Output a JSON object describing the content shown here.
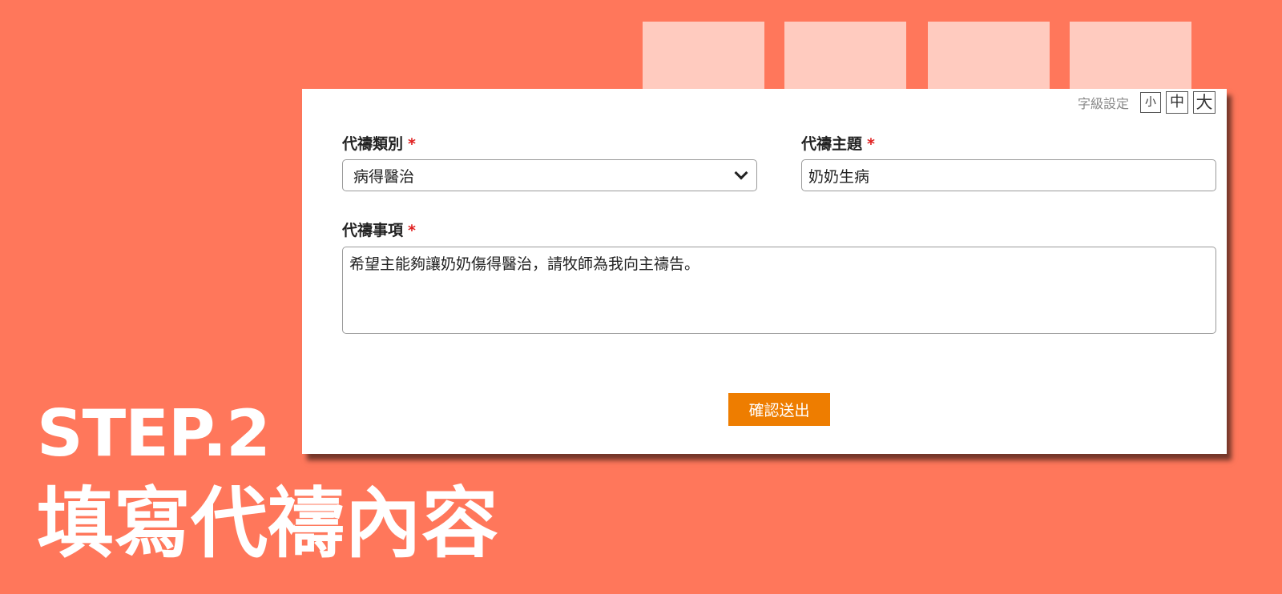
{
  "form": {
    "font_size_label": "字級設定",
    "font_size_options": [
      "小",
      "中",
      "大"
    ],
    "category_label": "代禱類別",
    "category_value": "病得醫治",
    "subject_label": "代禱主題",
    "subject_value": "奶奶生病",
    "details_label": "代禱事項",
    "details_value": "希望主能夠讓奶奶傷得醫治，請牧師為我向主禱告。",
    "required_mark": "*",
    "submit_label": "確認送出"
  },
  "banner": {
    "step": "STEP.2",
    "step_title": "填寫代禱內容"
  },
  "colors": {
    "background": "#ff775b",
    "tab_block": "#ffcbbf",
    "submit_button": "#ee7d00",
    "required_mark": "#e02020"
  }
}
